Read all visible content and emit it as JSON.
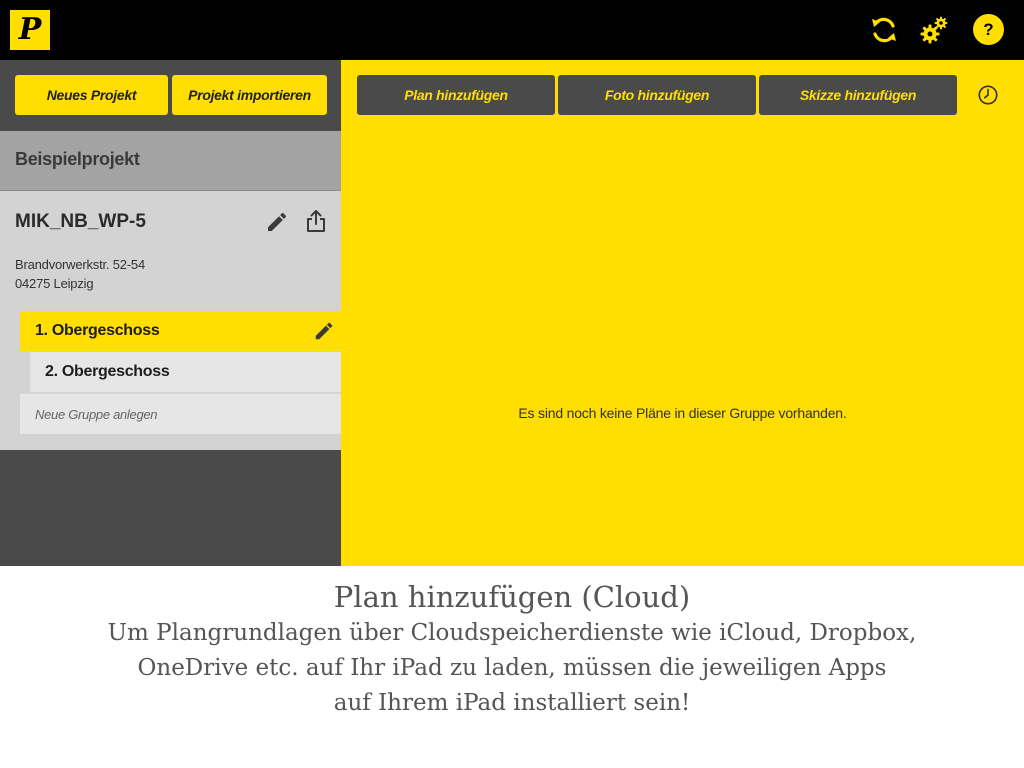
{
  "app": {
    "logo_letter": "P",
    "brand_color": "#ffde00",
    "top_icons": [
      "sync-icon",
      "settings-gears-icon",
      "help-icon"
    ],
    "help_label": "?"
  },
  "sidebar": {
    "new_project_label": "Neues Projekt",
    "import_project_label": "Projekt importieren",
    "project_group_title": "Beispielprojekt",
    "project": {
      "name": "MIK_NB_WP-5",
      "address_line1": "Brandvorwerkstr. 52-54",
      "address_line2": "04275 Leipzig"
    },
    "groups": [
      {
        "label": "1. Obergeschoss",
        "selected": true
      },
      {
        "label": "2. Obergeschoss",
        "selected": false
      }
    ],
    "new_group_label": "Neue Gruppe anlegen"
  },
  "main": {
    "add_plan_label": "Plan hinzufügen",
    "add_photo_label": "Foto hinzufügen",
    "add_sketch_label": "Skizze hinzufügen",
    "empty_message": "Es sind noch keine Pläne in dieser Gruppe vorhanden."
  },
  "caption": {
    "title": "Plan hinzufügen (Cloud)",
    "line1": "Um Plangrundlagen über Cloudspeicherdienste wie iCloud, Dropbox,",
    "line2": "OneDrive etc. auf Ihr iPad zu laden, müssen die jeweiligen Apps",
    "line3": "auf Ihrem iPad installiert sein!"
  }
}
